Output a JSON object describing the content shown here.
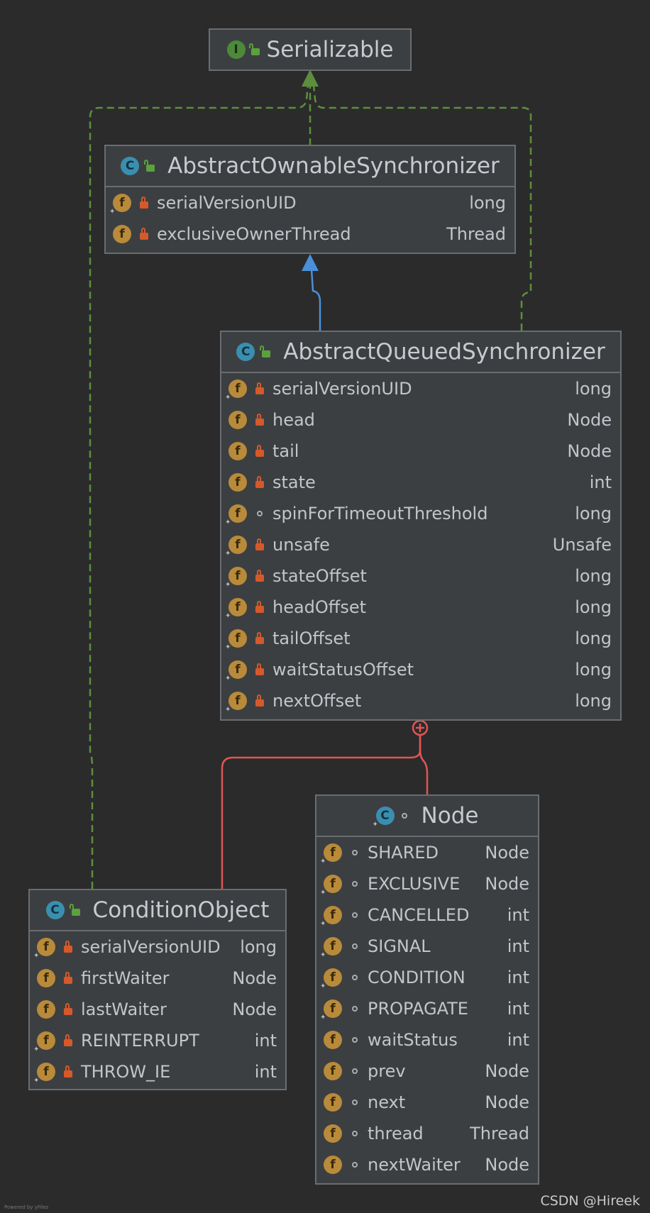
{
  "serializable": {
    "name": "Serializable",
    "kind": "I"
  },
  "aos": {
    "name": "AbstractOwnableSynchronizer",
    "fields": [
      {
        "name": "serialVersionUID",
        "type": "long"
      },
      {
        "name": "exclusiveOwnerThread",
        "type": "Thread"
      }
    ]
  },
  "aqs": {
    "name": "AbstractQueuedSynchronizer",
    "fields": [
      {
        "name": "serialVersionUID",
        "type": "long"
      },
      {
        "name": "head",
        "type": "Node"
      },
      {
        "name": "tail",
        "type": "Node"
      },
      {
        "name": "state",
        "type": "int"
      },
      {
        "name": "spinForTimeoutThreshold",
        "type": "long"
      },
      {
        "name": "unsafe",
        "type": "Unsafe"
      },
      {
        "name": "stateOffset",
        "type": "long"
      },
      {
        "name": "headOffset",
        "type": "long"
      },
      {
        "name": "tailOffset",
        "type": "long"
      },
      {
        "name": "waitStatusOffset",
        "type": "long"
      },
      {
        "name": "nextOffset",
        "type": "long"
      }
    ]
  },
  "node": {
    "name": "Node",
    "fields": [
      {
        "name": "SHARED",
        "type": "Node"
      },
      {
        "name": "EXCLUSIVE",
        "type": "Node"
      },
      {
        "name": "CANCELLED",
        "type": "int"
      },
      {
        "name": "SIGNAL",
        "type": "int"
      },
      {
        "name": "CONDITION",
        "type": "int"
      },
      {
        "name": "PROPAGATE",
        "type": "int"
      },
      {
        "name": "waitStatus",
        "type": "int"
      },
      {
        "name": "prev",
        "type": "Node"
      },
      {
        "name": "next",
        "type": "Node"
      },
      {
        "name": "thread",
        "type": "Thread"
      },
      {
        "name": "nextWaiter",
        "type": "Node"
      }
    ]
  },
  "cond": {
    "name": "ConditionObject",
    "fields": [
      {
        "name": "serialVersionUID",
        "type": "long"
      },
      {
        "name": "firstWaiter",
        "type": "Node"
      },
      {
        "name": "lastWaiter",
        "type": "Node"
      },
      {
        "name": "REINTERRUPT",
        "type": "int"
      },
      {
        "name": "THROW_IE",
        "type": "int"
      }
    ]
  },
  "icons": {
    "field": "f",
    "class": "C",
    "interface": "I"
  },
  "colors": {
    "background": "#2b2b2b",
    "box": "#3c3f41",
    "border": "#6a6d70",
    "implements": "#5c8f3d",
    "extends": "#4a90d9",
    "inner": "#e05555"
  },
  "credit": "CSDN @Hireek",
  "powered": "Powered by yFiles"
}
